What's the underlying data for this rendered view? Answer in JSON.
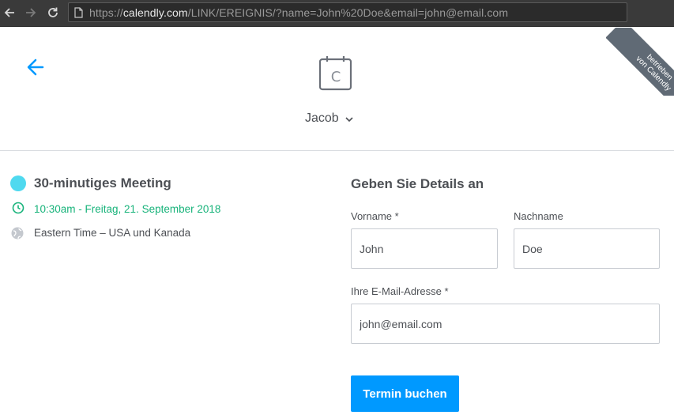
{
  "browser": {
    "url_prefix": "https://",
    "url_domain": "calendly.com",
    "url_path": "/LINK/EREIGNIS/?name=John%20Doe&email=john@email.com"
  },
  "header": {
    "calendar_letter": "C",
    "host_name": "Jacob",
    "ribbon_line1": "betrieben",
    "ribbon_line2": "von Calendly"
  },
  "event": {
    "name": "30-minutiges Meeting",
    "time": "10:30am - Freitag, 21. September 2018",
    "timezone": "Eastern Time – USA und Kanada",
    "dot_color": "#4fd9ef",
    "time_color": "#17b37a"
  },
  "form": {
    "title": "Geben Sie Details an",
    "first_name_label": "Vorname *",
    "first_name_value": "John",
    "last_name_label": "Nachname",
    "last_name_value": "Doe",
    "email_label": "Ihre E-Mail-Adresse *",
    "email_value": "john@email.com",
    "submit_label": "Termin buchen",
    "accent_color": "#0099ff"
  }
}
